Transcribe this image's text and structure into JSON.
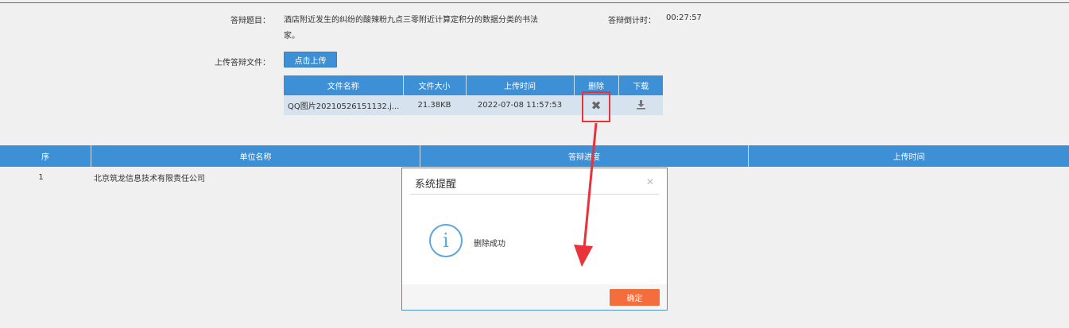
{
  "form": {
    "topic_label": "答辩题目：",
    "topic_text": "酒店附近发生的纠纷的酸辣粉九点三零附近计算定积分的数据分类的书法家。",
    "countdown_label": "答辩倒计时：",
    "countdown_value": "00:27:57",
    "upload_label": "上传答辩文件：",
    "upload_button": "点击上传"
  },
  "file_table": {
    "columns": [
      "文件名称",
      "文件大小",
      "上传时间",
      "删除",
      "下载"
    ],
    "rows": [
      {
        "name": "QQ图片20210526151132.j...",
        "size": "21.38KB",
        "time": "2022-07-08 11:57:53"
      }
    ],
    "delete_icon": "close-icon",
    "download_icon": "download-icon"
  },
  "main_table": {
    "columns": [
      "序",
      "单位名称",
      "答辩进度",
      "上传时间"
    ],
    "rows": [
      {
        "index": "1",
        "unit": "北京筑龙信息技术有限责任公司",
        "progress": "",
        "time": ""
      }
    ]
  },
  "dialog": {
    "title": "系统提醒",
    "close_icon": "close-icon",
    "info_icon": "info-icon",
    "info_glyph": "i",
    "message": "删除成功",
    "ok_button": "确定"
  },
  "colors": {
    "header_blue": "#3d8fd6",
    "row_blue": "#d6e2ee",
    "ok_orange": "#f46d3c",
    "annotation_red": "#e8333a"
  }
}
